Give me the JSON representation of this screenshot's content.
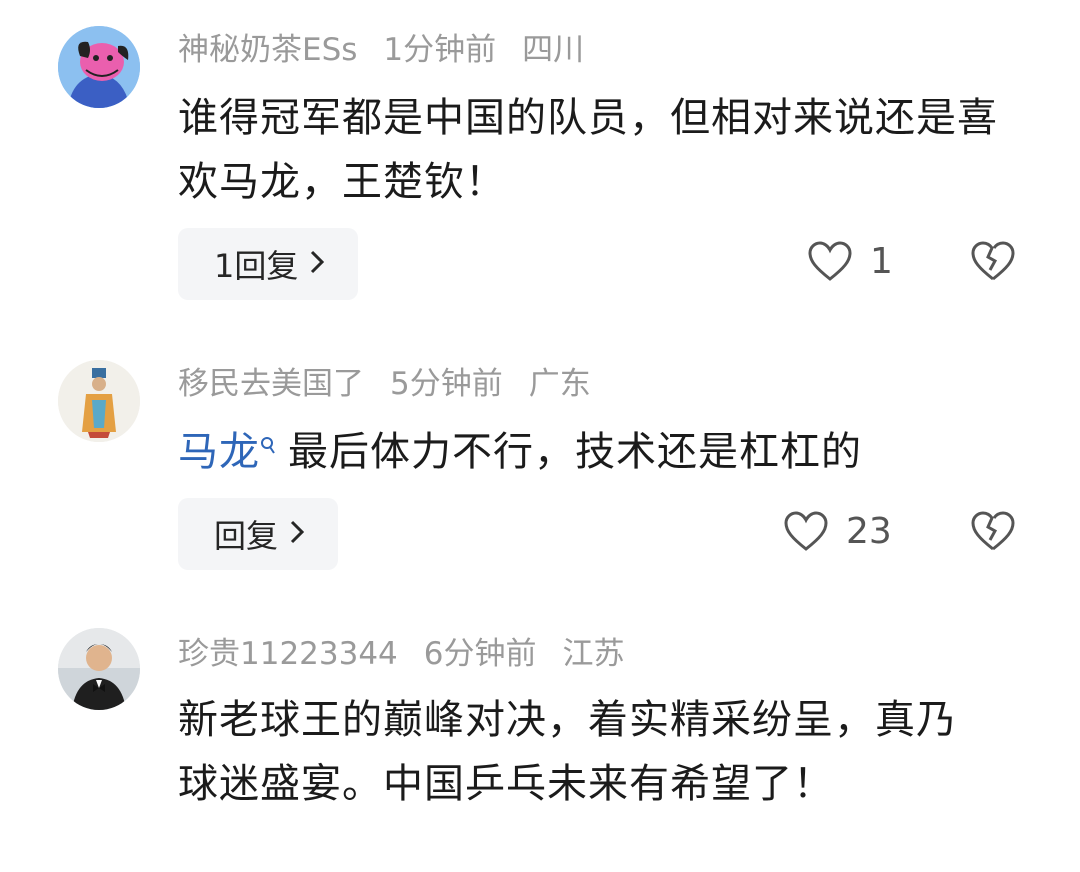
{
  "comments": [
    {
      "username": "神秘奶茶ESs",
      "time": "1分钟前",
      "location": "四川",
      "text": "谁得冠军都是中国的队员，但相对来说还是喜欢马龙，王楚钦！",
      "reply_label": "1回复",
      "likes": "1",
      "avatar_colors": {
        "bg": "#7fb7ef",
        "figure": "#e95aa8"
      }
    },
    {
      "username": "移民去美国了",
      "time": "5分钟前",
      "location": "广东",
      "mention": "马龙",
      "text": "最后体力不行，技术还是杠杠的",
      "reply_label": "回复",
      "likes": "23",
      "avatar_colors": {
        "bg": "#f1efe9",
        "figure": "#d9963a"
      }
    },
    {
      "username": "珍贵11223344",
      "time": "6分钟前",
      "location": "江苏",
      "text": "新老球王的巅峰对决，着实精采纷呈，真乃球迷盛宴。中国乒乓未来有希望了！",
      "avatar_colors": {
        "bg": "#dfe3e6",
        "figure": "#2b2b2b"
      }
    }
  ],
  "icons": {
    "like": "heart-outline-icon",
    "dislike": "broken-heart-icon",
    "reply_chevron": "chevron-right-icon"
  },
  "mention_icon": "search-icon"
}
